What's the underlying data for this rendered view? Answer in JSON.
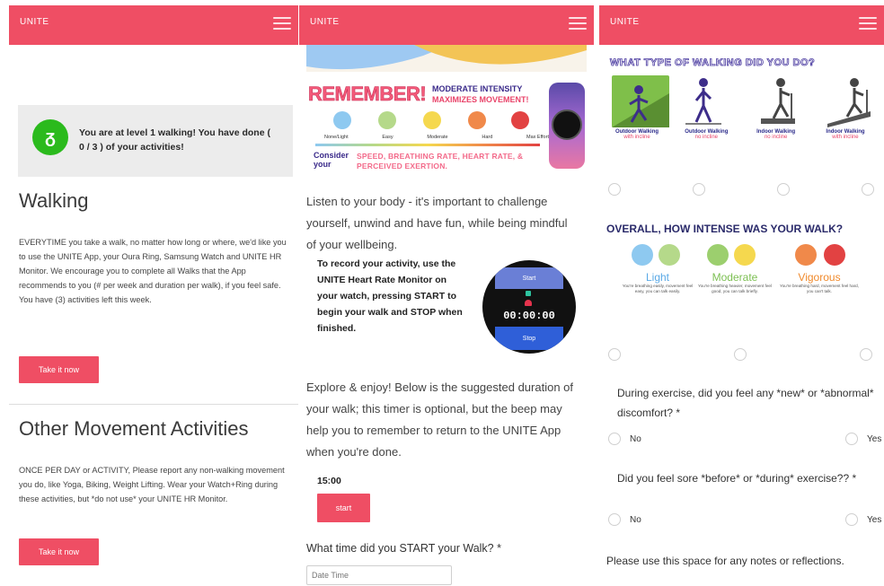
{
  "app": {
    "brand": "UNITE"
  },
  "panel1": {
    "level_badge_glyph": "ᵹ",
    "level_text": "You are at level 1 walking! You have done ( 0 / 3 ) of your activities!",
    "walking_title": "Walking",
    "walking_desc": "EVERYTIME you take a walk, no matter how long or where, we'd like you to use the UNITE App, your Oura Ring, Samsung Watch and UNITE HR Monitor. We encourage you to complete all Walks that the App recommends to you (# per week and duration per walk), if you feel safe.",
    "walking_remaining": "You have (3) activities left this week.",
    "take_it_now_1": "Take it now",
    "other_title": "Other Movement Activities",
    "other_desc": "ONCE PER DAY or ACTIVITY, Please report any non-walking movement you do, like Yoga, Biking, Weight Lifting. Wear your Watch+Ring during these activities, but *do not use* your UNITE HR Monitor.",
    "take_it_now_2": "Take it now"
  },
  "panel2": {
    "remember_title": "REMEMBER!",
    "remember_sub1": "MODERATE INTENSITY",
    "remember_sub2": "MAXIMIZES MOVEMENT!",
    "scale_labels": [
      "None/Light",
      "Easy",
      "Moderate",
      "Hard",
      "Max Effort"
    ],
    "consider_label": "Consider your",
    "consider_text": "SPEED, BREATHING RATE, HEART RATE, & PERCEIVED EXERTION.",
    "listen_text": "Listen to your body - it's important to challenge yourself, unwind and have fun, while being mindful of your wellbeing.",
    "record_text": "To record your activity, use the UNITE Heart Rate Monitor on your watch, pressing START to begin your walk and STOP when finished.",
    "watch_start": "Start",
    "watch_time": "00:00:00",
    "watch_stop": "Stop",
    "explore_text": "Explore & enjoy! Below is the suggested duration of your walk; this timer is optional, but the beep may help you to remember to return to the UNITE App when you're done.",
    "timer_value": "15:00",
    "start_button": "start",
    "start_time_question": "What time did you START your Walk? *",
    "date_time_placeholder": "Date Time"
  },
  "panel3": {
    "walk_type_title": "WHAT TYPE OF WALKING DID YOU DO?",
    "walk_types": [
      {
        "label": "Outdoor Walking",
        "sub": "with incline"
      },
      {
        "label": "Outdoor Walking",
        "sub": "no incline"
      },
      {
        "label": "Indoor Walking",
        "sub": "no incline"
      },
      {
        "label": "Indoor Walking",
        "sub": "with incline"
      }
    ],
    "intensity_title": "OVERALL, HOW INTENSE WAS YOUR WALK?",
    "intensity_levels": [
      {
        "label": "Light",
        "desc": "You're breathing easily, movement feel easy, you can talk easily.",
        "color": "#5aa9e6"
      },
      {
        "label": "Moderate",
        "desc": "You're breathing heavier, movement feel good, you can talk briefly.",
        "color": "#7cbf52"
      },
      {
        "label": "Vigorous",
        "desc": "You're breathing hard, movement feel hard, you can't talk.",
        "color": "#f08a2c"
      }
    ],
    "discomfort_question": "During exercise, did you feel any *new* or *abnormal* discomfort? *",
    "discomfort_no": "No",
    "discomfort_yes": "Yes",
    "sore_question": "Did you feel sore *before* or *during* exercise?? *",
    "sore_no": "No",
    "sore_yes": "Yes",
    "notes_prompt": "Please use this space for any notes or reflections."
  }
}
